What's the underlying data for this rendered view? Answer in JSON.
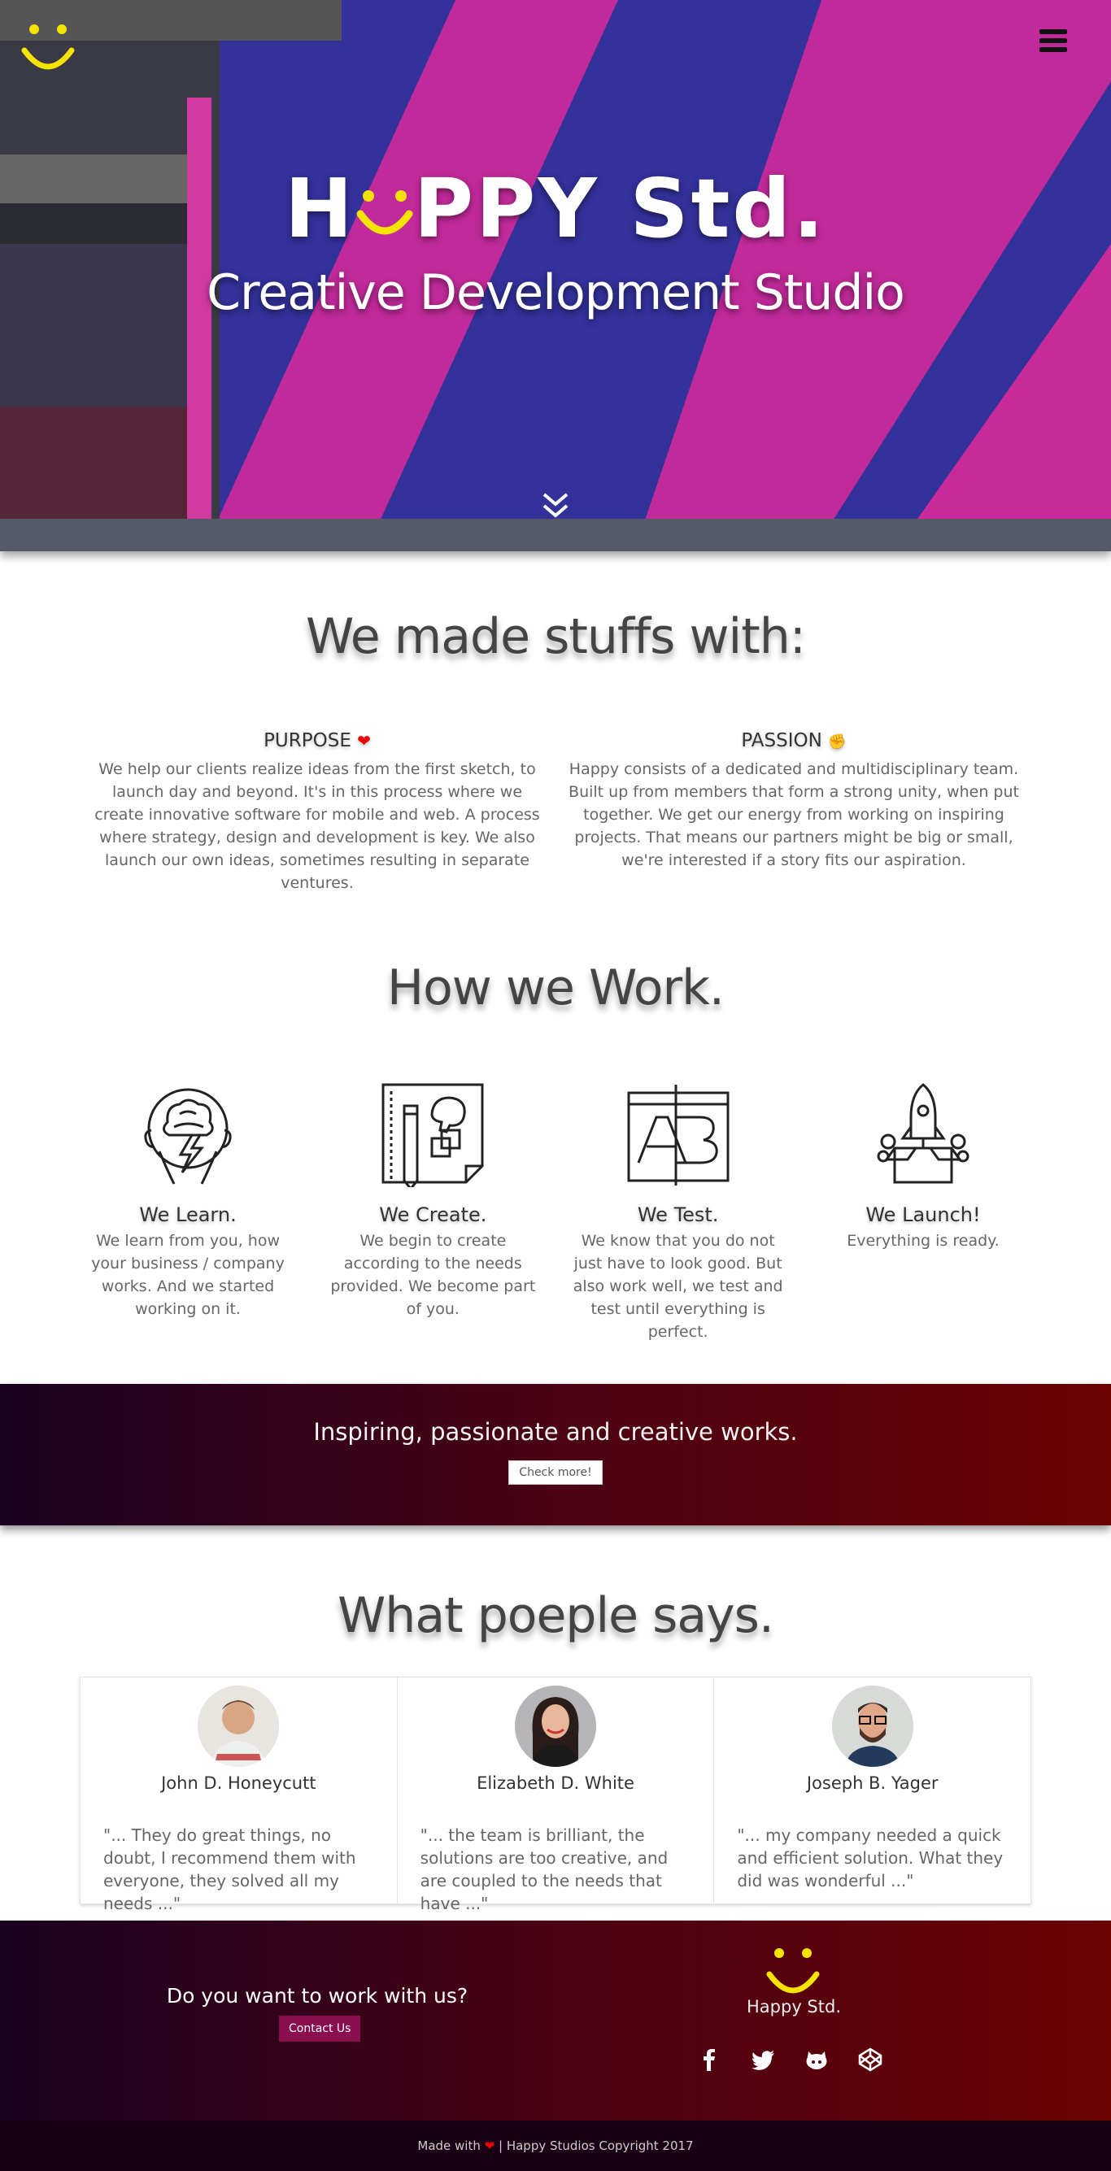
{
  "hero": {
    "title_before": "H",
    "title_after": "PPY Std.",
    "subtitle": "Creative Development Studio"
  },
  "made": {
    "title": "We made stuffs with:",
    "purpose": {
      "label": "PURPOSE",
      "icon": "heart-icon",
      "text": "We help our clients realize ideas from the first sketch, to launch day and beyond. It's in this process where we create innovative software for mobile and web. A process where strategy, design and development is key. We also launch our own ideas, sometimes resulting in separate ventures."
    },
    "passion": {
      "label": "PASSION",
      "icon": "fist-icon",
      "text": "Happy consists of a dedicated and multidisciplinary team. Built up from members that form a strong unity, when put together. We get our energy from working on inspiring projects. That means our partners might be big or small, we're interested if a story fits our aspiration."
    }
  },
  "how": {
    "title": "How we Work.",
    "items": [
      {
        "title": "We Learn.",
        "text": "We learn from you, how your business / company works. And we started working on it.",
        "icon": "brain-icon"
      },
      {
        "title": "We Create.",
        "text": "We begin to create according to the needs provided. We become part of you.",
        "icon": "design-icon"
      },
      {
        "title": "We Test.",
        "text": "We know that you do not just have to look good. But also work well, we test and test until everything is perfect.",
        "icon": "ab-test-icon"
      },
      {
        "title": "We Launch!",
        "text": "Everything is ready.",
        "icon": "rocket-icon"
      }
    ]
  },
  "banner": {
    "text": "Inspiring, passionate and creative works.",
    "button": "Check more!"
  },
  "testimonials": {
    "title": "What poeple says.",
    "items": [
      {
        "name": "John D. Honeycutt",
        "quote": "\"... They do great things, no doubt, I recommend them with everyone, they solved all my needs ...\""
      },
      {
        "name": "Elizabeth D. White",
        "quote": "\"... the team is brilliant, the solutions are too creative, and are coupled to the needs that have ...\""
      },
      {
        "name": "Joseph B. Yager",
        "quote": "\"... my company needed a quick and efficient solution. What they did was wonderful ...\""
      }
    ]
  },
  "footer": {
    "question": "Do you want to work with us?",
    "contact": "Contact Us",
    "brand": "Happy Std.",
    "social": [
      "facebook-icon",
      "twitter-icon",
      "github-icon",
      "codepen-icon"
    ]
  },
  "bottom": {
    "made_with": "Made with",
    "rest": "| Happy Studios Copyright 2017"
  },
  "colors": {
    "accent_yellow": "#f5e400",
    "hero_blue": "#33319a",
    "hero_pink": "#c92a9a",
    "banner_dark": "#1a0220",
    "banner_red": "#6a0202",
    "contact_button": "#8a0e4e"
  }
}
